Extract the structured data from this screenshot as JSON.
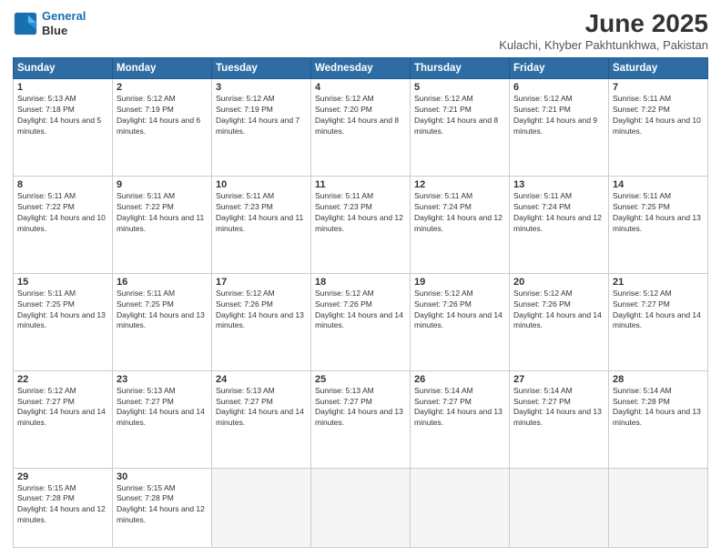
{
  "logo": {
    "line1": "General",
    "line2": "Blue"
  },
  "title": "June 2025",
  "subtitle": "Kulachi, Khyber Pakhtunkhwa, Pakistan",
  "headers": [
    "Sunday",
    "Monday",
    "Tuesday",
    "Wednesday",
    "Thursday",
    "Friday",
    "Saturday"
  ],
  "rows": [
    [
      {
        "day": "1",
        "sunrise": "5:13 AM",
        "sunset": "7:18 PM",
        "daylight": "14 hours and 5 minutes."
      },
      {
        "day": "2",
        "sunrise": "5:12 AM",
        "sunset": "7:19 PM",
        "daylight": "14 hours and 6 minutes."
      },
      {
        "day": "3",
        "sunrise": "5:12 AM",
        "sunset": "7:19 PM",
        "daylight": "14 hours and 7 minutes."
      },
      {
        "day": "4",
        "sunrise": "5:12 AM",
        "sunset": "7:20 PM",
        "daylight": "14 hours and 8 minutes."
      },
      {
        "day": "5",
        "sunrise": "5:12 AM",
        "sunset": "7:21 PM",
        "daylight": "14 hours and 8 minutes."
      },
      {
        "day": "6",
        "sunrise": "5:12 AM",
        "sunset": "7:21 PM",
        "daylight": "14 hours and 9 minutes."
      },
      {
        "day": "7",
        "sunrise": "5:11 AM",
        "sunset": "7:22 PM",
        "daylight": "14 hours and 10 minutes."
      }
    ],
    [
      {
        "day": "8",
        "sunrise": "5:11 AM",
        "sunset": "7:22 PM",
        "daylight": "14 hours and 10 minutes."
      },
      {
        "day": "9",
        "sunrise": "5:11 AM",
        "sunset": "7:22 PM",
        "daylight": "14 hours and 11 minutes."
      },
      {
        "day": "10",
        "sunrise": "5:11 AM",
        "sunset": "7:23 PM",
        "daylight": "14 hours and 11 minutes."
      },
      {
        "day": "11",
        "sunrise": "5:11 AM",
        "sunset": "7:23 PM",
        "daylight": "14 hours and 12 minutes."
      },
      {
        "day": "12",
        "sunrise": "5:11 AM",
        "sunset": "7:24 PM",
        "daylight": "14 hours and 12 minutes."
      },
      {
        "day": "13",
        "sunrise": "5:11 AM",
        "sunset": "7:24 PM",
        "daylight": "14 hours and 12 minutes."
      },
      {
        "day": "14",
        "sunrise": "5:11 AM",
        "sunset": "7:25 PM",
        "daylight": "14 hours and 13 minutes."
      }
    ],
    [
      {
        "day": "15",
        "sunrise": "5:11 AM",
        "sunset": "7:25 PM",
        "daylight": "14 hours and 13 minutes."
      },
      {
        "day": "16",
        "sunrise": "5:11 AM",
        "sunset": "7:25 PM",
        "daylight": "14 hours and 13 minutes."
      },
      {
        "day": "17",
        "sunrise": "5:12 AM",
        "sunset": "7:26 PM",
        "daylight": "14 hours and 13 minutes."
      },
      {
        "day": "18",
        "sunrise": "5:12 AM",
        "sunset": "7:26 PM",
        "daylight": "14 hours and 14 minutes."
      },
      {
        "day": "19",
        "sunrise": "5:12 AM",
        "sunset": "7:26 PM",
        "daylight": "14 hours and 14 minutes."
      },
      {
        "day": "20",
        "sunrise": "5:12 AM",
        "sunset": "7:26 PM",
        "daylight": "14 hours and 14 minutes."
      },
      {
        "day": "21",
        "sunrise": "5:12 AM",
        "sunset": "7:27 PM",
        "daylight": "14 hours and 14 minutes."
      }
    ],
    [
      {
        "day": "22",
        "sunrise": "5:12 AM",
        "sunset": "7:27 PM",
        "daylight": "14 hours and 14 minutes."
      },
      {
        "day": "23",
        "sunrise": "5:13 AM",
        "sunset": "7:27 PM",
        "daylight": "14 hours and 14 minutes."
      },
      {
        "day": "24",
        "sunrise": "5:13 AM",
        "sunset": "7:27 PM",
        "daylight": "14 hours and 14 minutes."
      },
      {
        "day": "25",
        "sunrise": "5:13 AM",
        "sunset": "7:27 PM",
        "daylight": "14 hours and 13 minutes."
      },
      {
        "day": "26",
        "sunrise": "5:14 AM",
        "sunset": "7:27 PM",
        "daylight": "14 hours and 13 minutes."
      },
      {
        "day": "27",
        "sunrise": "5:14 AM",
        "sunset": "7:27 PM",
        "daylight": "14 hours and 13 minutes."
      },
      {
        "day": "28",
        "sunrise": "5:14 AM",
        "sunset": "7:28 PM",
        "daylight": "14 hours and 13 minutes."
      }
    ],
    [
      {
        "day": "29",
        "sunrise": "5:15 AM",
        "sunset": "7:28 PM",
        "daylight": "14 hours and 12 minutes."
      },
      {
        "day": "30",
        "sunrise": "5:15 AM",
        "sunset": "7:28 PM",
        "daylight": "14 hours and 12 minutes."
      },
      null,
      null,
      null,
      null,
      null
    ]
  ]
}
